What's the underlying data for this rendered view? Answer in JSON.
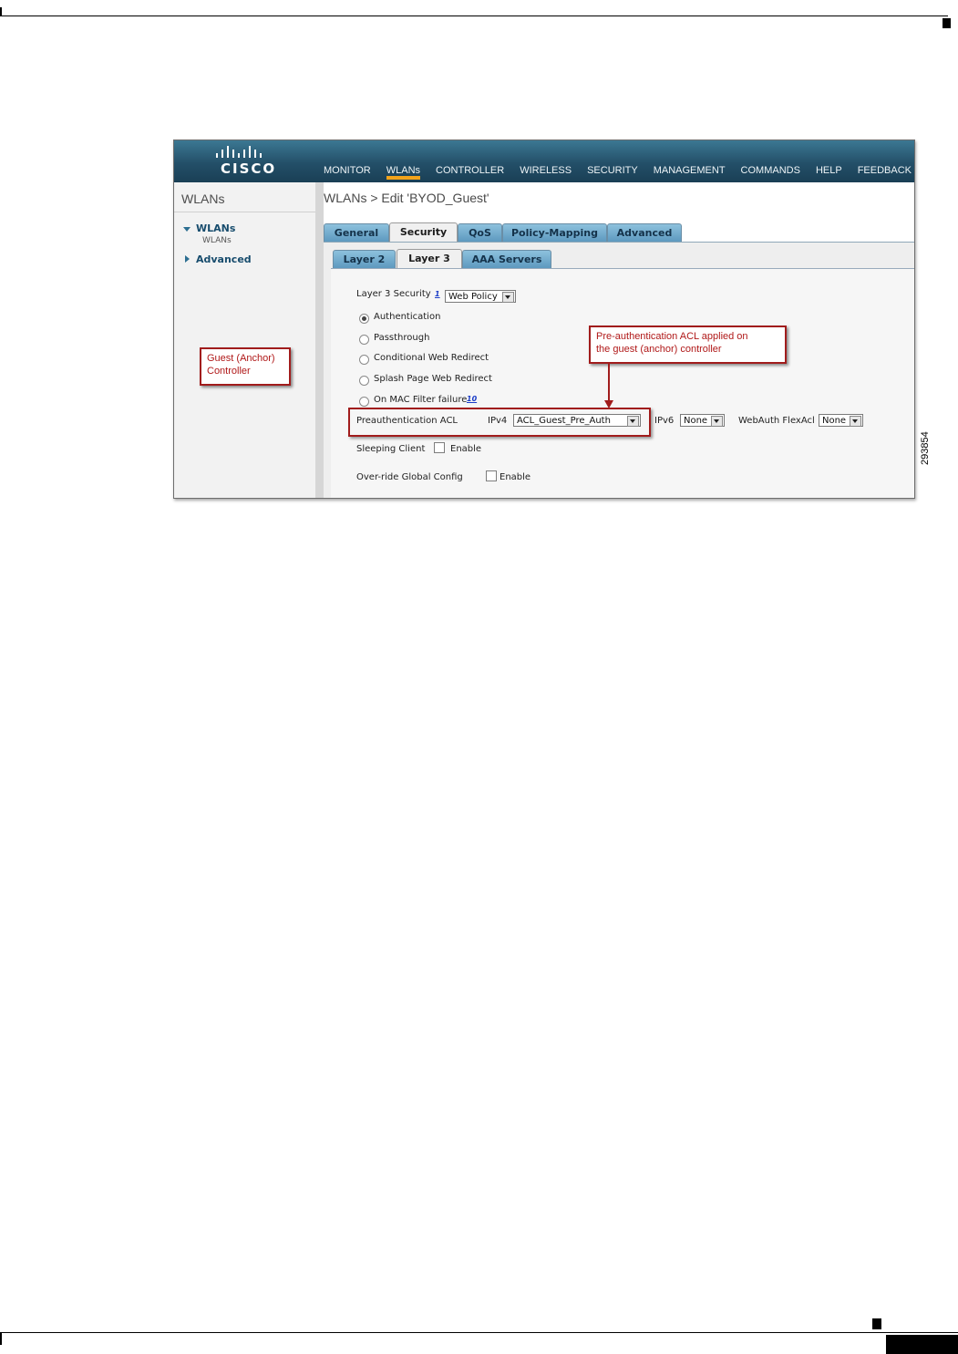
{
  "header": {
    "brand": "CISCO",
    "nav": [
      "MONITOR",
      "WLANs",
      "CONTROLLER",
      "WIRELESS",
      "SECURITY",
      "MANAGEMENT",
      "COMMANDS",
      "HELP",
      "FEEDBACK"
    ],
    "active_nav": "WLANs",
    "accent_color": "#f3a31b"
  },
  "sidebar": {
    "title": "WLANs",
    "items": [
      {
        "label": "WLANs",
        "sub": "WLANs",
        "expanded": true
      },
      {
        "label": "Advanced",
        "expanded": false
      }
    ]
  },
  "main": {
    "title": "WLANs > Edit  'BYOD_Guest'",
    "tabs": [
      "General",
      "Security",
      "QoS",
      "Policy-Mapping",
      "Advanced"
    ],
    "active_tab": "Security",
    "subtabs": [
      "Layer 2",
      "Layer 3",
      "AAA Servers"
    ],
    "active_subtab": "Layer 3",
    "layer3_security_label": "Layer 3 Security",
    "layer3_security_help": "1",
    "layer3_security_value": "Web Policy",
    "radios": [
      {
        "label": "Authentication",
        "checked": true
      },
      {
        "label": "Passthrough",
        "checked": false
      },
      {
        "label": "Conditional Web Redirect",
        "checked": false
      },
      {
        "label": "Splash Page Web Redirect",
        "checked": false
      },
      {
        "label": "On MAC Filter failure",
        "checked": false,
        "help": "10"
      }
    ],
    "preauth": {
      "label": "Preauthentication ACL",
      "ipv4_label": "IPv4",
      "ipv4_value": "ACL_Guest_Pre_Auth",
      "ipv6_label": "IPv6",
      "ipv6_value": "None",
      "flexacl_label": "WebAuth FlexAcl",
      "flexacl_value": "None"
    },
    "sleeping_client": {
      "label": "Sleeping Client",
      "checkbox_label": "Enable",
      "checked": false
    },
    "override": {
      "label": "Over-ride Global Config",
      "checkbox_label": "Enable",
      "checked": false
    }
  },
  "annotations": {
    "guest_callout": "Guest (Anchor)\nController",
    "preauth_callout": "Pre-authentication ACL applied on\nthe guest (anchor) controller",
    "callout_color": "#a11c1c"
  },
  "figure_id": "293854"
}
